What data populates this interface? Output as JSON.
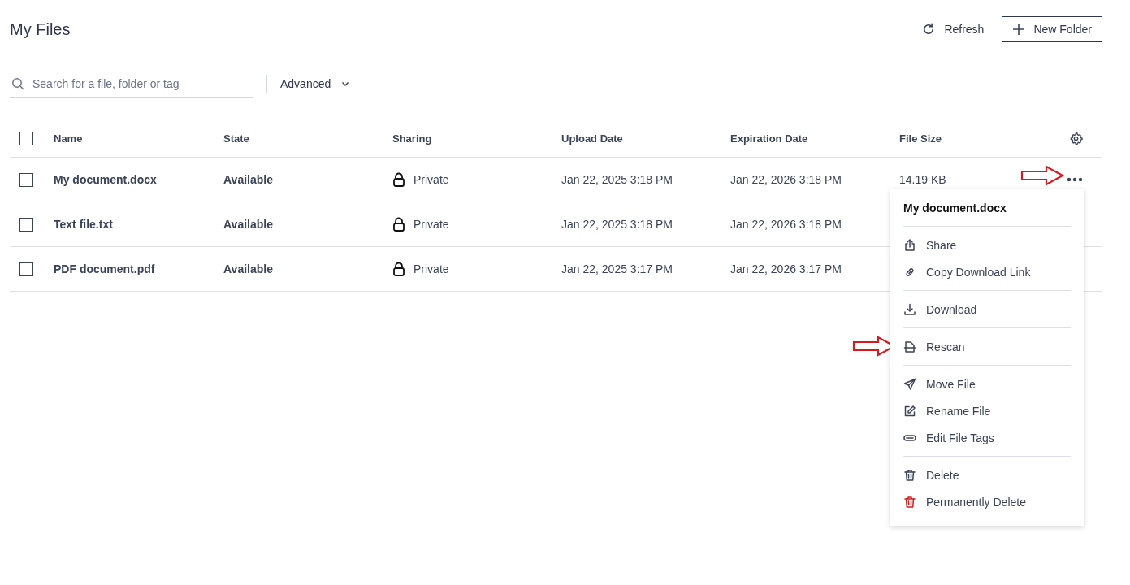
{
  "page": {
    "title": "My Files"
  },
  "toolbar": {
    "refresh": "Refresh",
    "new_folder": "New Folder"
  },
  "search": {
    "placeholder": "Search for a file, folder or tag",
    "advanced": "Advanced"
  },
  "table": {
    "all_checked": false,
    "columns": [
      "Name",
      "State",
      "Sharing",
      "Upload Date",
      "Expiration Date",
      "File Size"
    ],
    "rows": [
      {
        "checked": false,
        "name": "My document.docx",
        "state": "Available",
        "sharing": "Private",
        "upload": "Jan 22, 2025 3:18 PM",
        "expiration": "Jan 22, 2026 3:18 PM",
        "size": "14.19 KB"
      },
      {
        "checked": false,
        "name": "Text file.txt",
        "state": "Available",
        "sharing": "Private",
        "upload": "Jan 22, 2025 3:18 PM",
        "expiration": "Jan 22, 2026 3:18 PM"
      },
      {
        "checked": false,
        "name": "PDF document.pdf",
        "state": "Available",
        "sharing": "Private",
        "upload": "Jan 22, 2025 3:17 PM",
        "expiration": "Jan 22, 2026 3:17 PM"
      }
    ]
  },
  "context_menu": {
    "title": "My document.docx",
    "groups": [
      [
        {
          "kind": "share",
          "label": "Share",
          "danger": false
        },
        {
          "kind": "link",
          "label": "Copy Download Link",
          "danger": false
        }
      ],
      [
        {
          "kind": "download",
          "label": "Download",
          "danger": false
        }
      ],
      [
        {
          "kind": "rescan",
          "label": "Rescan",
          "danger": false
        }
      ],
      [
        {
          "kind": "move",
          "label": "Move File",
          "danger": false
        },
        {
          "kind": "rename",
          "label": "Rename File",
          "danger": false
        },
        {
          "kind": "tags",
          "label": "Edit File Tags",
          "danger": false
        }
      ],
      [
        {
          "kind": "delete",
          "label": "Delete",
          "danger": false
        },
        {
          "kind": "delete",
          "label": "Permanently Delete",
          "danger": true
        }
      ]
    ]
  }
}
